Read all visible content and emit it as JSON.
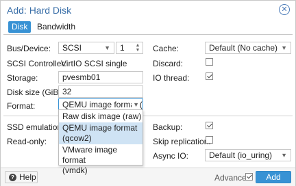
{
  "window": {
    "title": "Add: Hard Disk"
  },
  "tabs": [
    {
      "label": "Disk",
      "active": true
    },
    {
      "label": "Bandwidth",
      "active": false
    }
  ],
  "left": {
    "bus_device_label": "Bus/Device:",
    "bus_value": "SCSI",
    "device_value": "1",
    "scsi_controller_label": "SCSI Controller:",
    "scsi_controller_value": "VirtIO SCSI single",
    "storage_label": "Storage:",
    "storage_value": "pvesmb01",
    "disk_size_label": "Disk size (GiB):",
    "disk_size_value": "32",
    "format_label": "Format:",
    "format_value": "QEMU image format (qc"
  },
  "right": {
    "cache_label": "Cache:",
    "cache_value": "Default (No cache)",
    "discard_label": "Discard:",
    "discard_checked": false,
    "io_thread_label": "IO thread:",
    "io_thread_checked": true
  },
  "advanced": {
    "ssd_emulation_label": "SSD emulation:",
    "read_only_label": "Read-only:",
    "backup_label": "Backup:",
    "backup_checked": true,
    "skip_replication_label": "Skip replication:",
    "skip_replication_checked": false,
    "async_io_label": "Async IO:",
    "async_io_value": "Default (io_uring)"
  },
  "format_dropdown": {
    "options": [
      {
        "label": "Raw disk image (raw)",
        "selected": false
      },
      {
        "label": "QEMU image format (qcow2)",
        "line1": "QEMU image format",
        "line2": "(qcow2)",
        "selected": true
      },
      {
        "label": "VMware image format (vmdk)",
        "line1": "VMware image format",
        "line2": "(vmdk)",
        "selected": false
      }
    ]
  },
  "footer": {
    "help_label": "Help",
    "advanced_label": "Advanced",
    "advanced_checked": true,
    "add_label": "Add"
  },
  "colors": {
    "accent": "#3892d4",
    "title": "#3a6fa8",
    "selected_option": "#cfe3f4"
  },
  "icons": {
    "close": "close-circle-icon",
    "help": "help-circle-icon",
    "dropdown": "chevron-down-icon",
    "spinner": "spinner-updown-icon",
    "check": "check-icon"
  }
}
